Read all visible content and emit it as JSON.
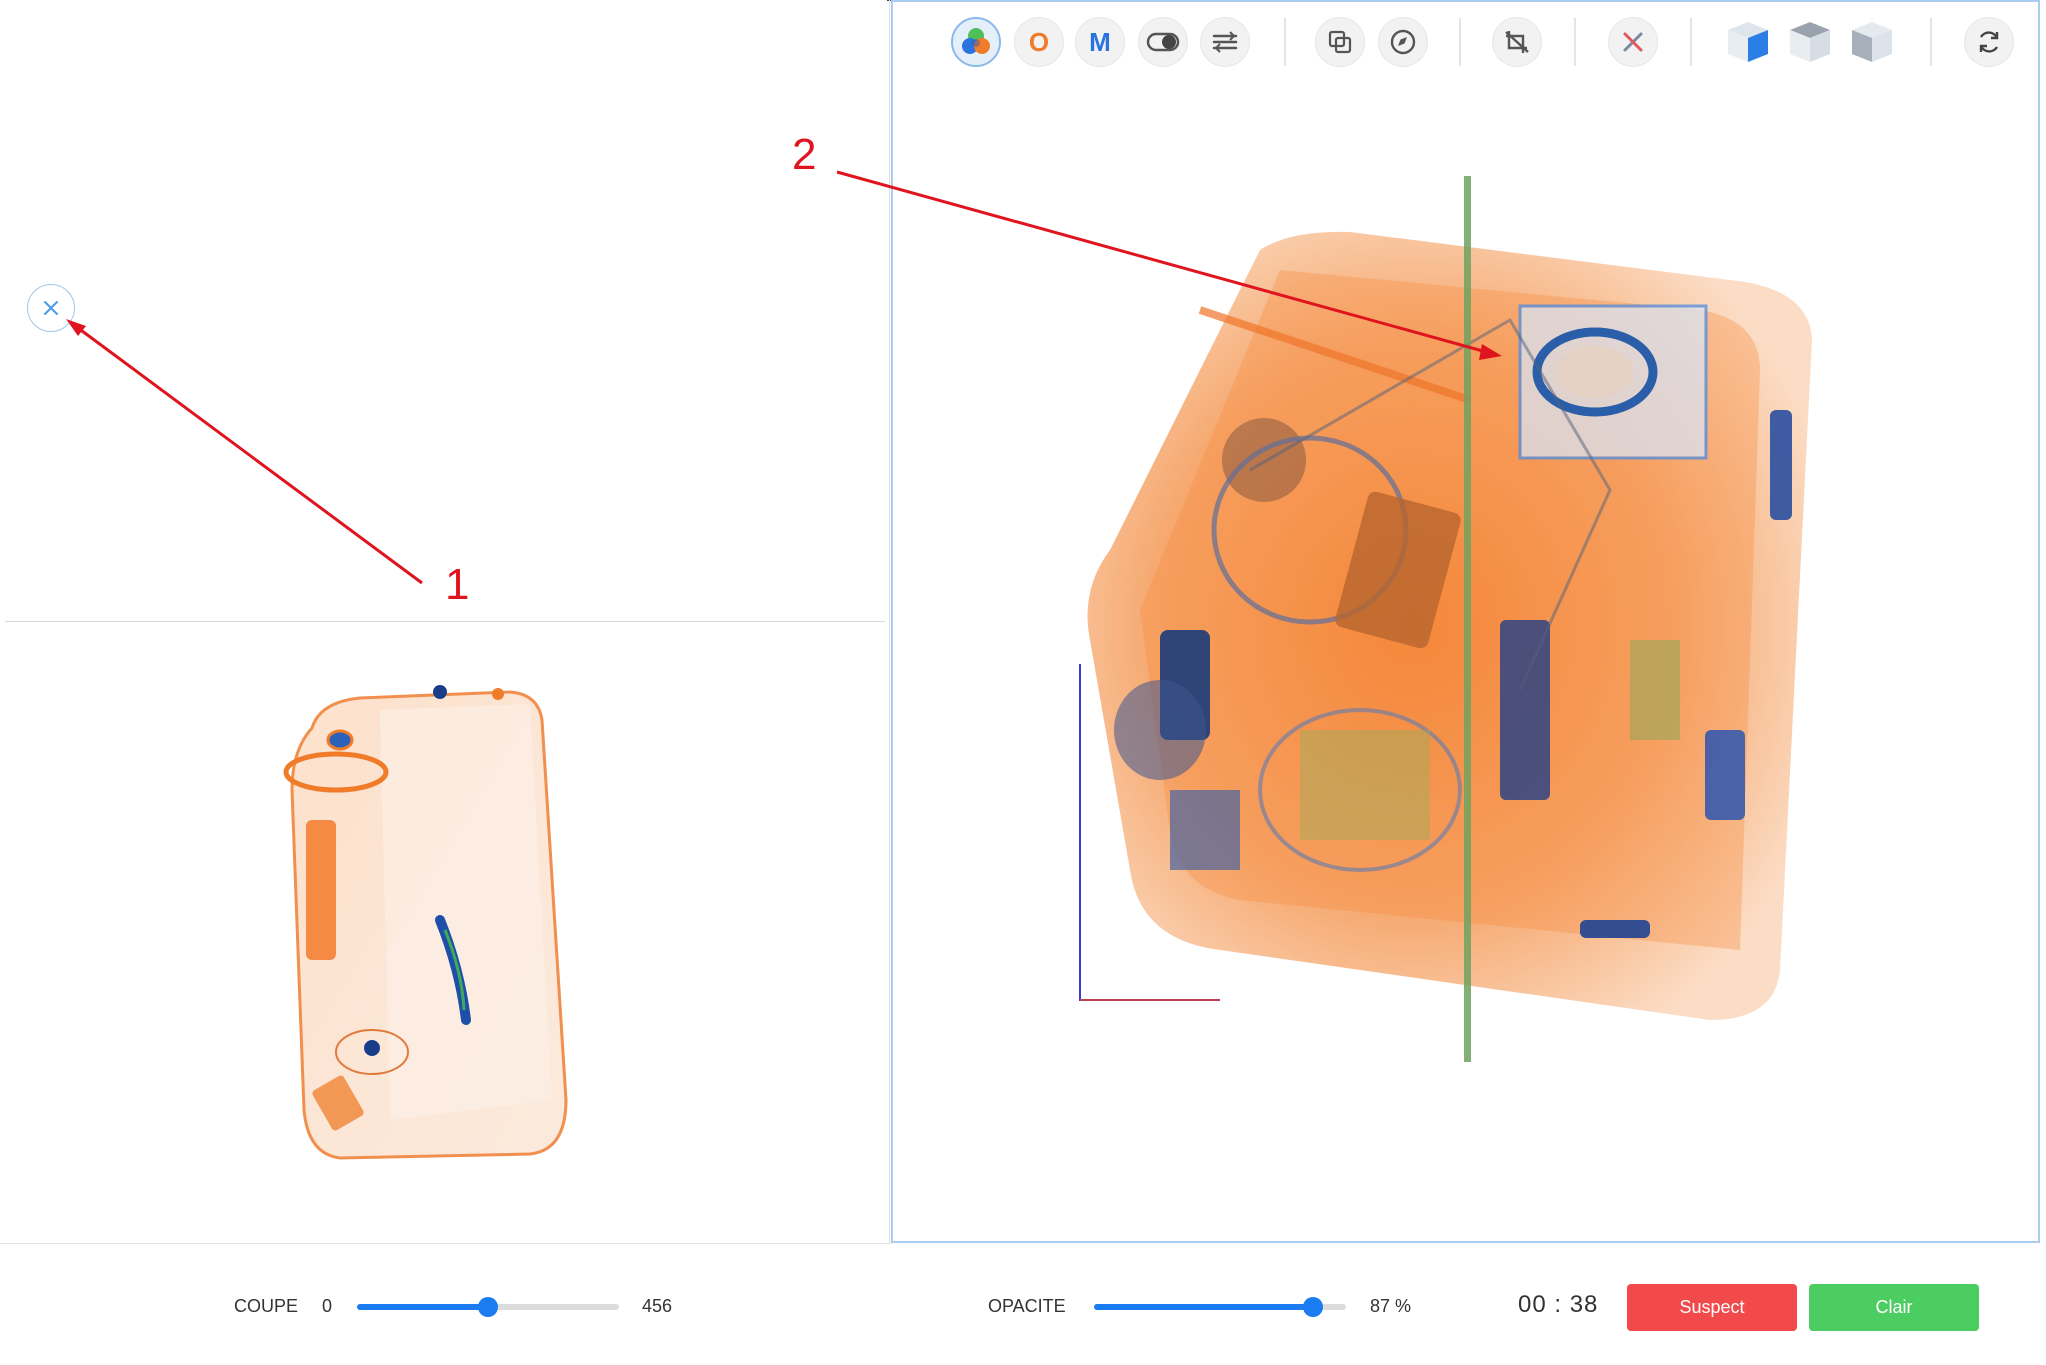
{
  "toolbar": {
    "buttons": [
      {
        "name": "color-palette-icon"
      },
      {
        "name": "organic-filter-icon",
        "letter": "O",
        "color": "#f07c2a"
      },
      {
        "name": "metal-filter-icon",
        "letter": "M",
        "color": "#2a74e0"
      },
      {
        "name": "contrast-toggle-icon"
      },
      {
        "name": "adjust-sliders-icon"
      },
      {
        "name": "layers-copy-icon"
      },
      {
        "name": "compass-icon"
      },
      {
        "name": "crop-off-icon"
      },
      {
        "name": "tools-off-icon"
      },
      {
        "name": "cube-front-view-icon"
      },
      {
        "name": "cube-top-view-icon"
      },
      {
        "name": "cube-side-view-icon"
      },
      {
        "name": "reset-rotate-icon"
      }
    ]
  },
  "left_panel": {
    "close_icon": "close-icon"
  },
  "annotations": {
    "label_1": "1",
    "label_2": "2",
    "arrow_color": "#e0141e"
  },
  "footer": {
    "coupe": {
      "label": "COUPE",
      "min": "0",
      "max": "456",
      "value_fraction": 0.5
    },
    "opacite": {
      "label": "OPACITE",
      "value": "87 %",
      "value_fraction": 0.87
    },
    "timer": "00 : 38",
    "suspect_label": "Suspect",
    "clear_label": "Clair"
  },
  "colors": {
    "accent": "#1a7cf0",
    "suspect": "#f24a4a",
    "clear": "#4ccd62",
    "organic": "#f07c2a",
    "metal": "#2a74e0"
  }
}
